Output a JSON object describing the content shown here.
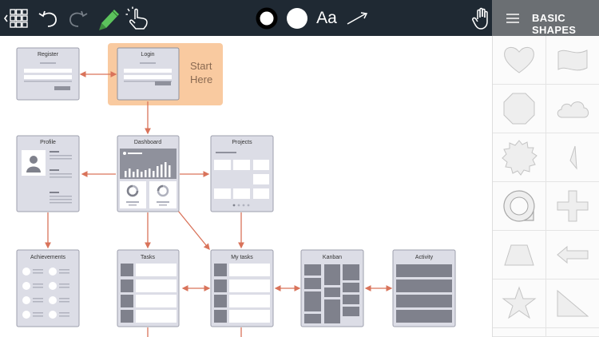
{
  "toolbar": {
    "buttons": [
      {
        "name": "back-grid-button",
        "icon": "grid-back-icon"
      },
      {
        "name": "undo-button",
        "icon": "undo-icon"
      },
      {
        "name": "redo-button",
        "icon": "redo-icon"
      },
      {
        "name": "pen-tool-button",
        "icon": "pencil-icon"
      },
      {
        "name": "touch-select-button",
        "icon": "hand-pointer-icon"
      },
      {
        "name": "stroke-color-button",
        "icon": "ring-icon"
      },
      {
        "name": "fill-color-button",
        "icon": "filled-circle-icon"
      },
      {
        "name": "text-tool-button",
        "icon": "text-icon"
      },
      {
        "name": "line-tool-button",
        "icon": "arrow-line-icon"
      },
      {
        "name": "pan-tool-button",
        "icon": "hand-icon"
      }
    ],
    "text_tool_label": "Aa",
    "active_color": "#5cc35c"
  },
  "panel": {
    "menu_icon": "hamburger-icon",
    "title": "BASIC SHAPES",
    "shapes": [
      "heart",
      "flag",
      "octagon",
      "cloud",
      "seal",
      "triangle",
      "ring-tag",
      "plus",
      "trapezoid",
      "left-arrow",
      "star",
      "right-triangle"
    ]
  },
  "diagram": {
    "start_label_line1": "Start",
    "start_label_line2": "Here",
    "highlight_color": "#f9caa0",
    "connector_color": "#d9735a",
    "cards": {
      "register": "Register",
      "login": "Login",
      "profile": "Profile",
      "dashboard": "Dashboard",
      "projects": "Projects",
      "achievements": "Achievements",
      "tasks": "Tasks",
      "my_tasks": "My tasks",
      "kanban": "Kanban",
      "activity": "Activity"
    }
  }
}
